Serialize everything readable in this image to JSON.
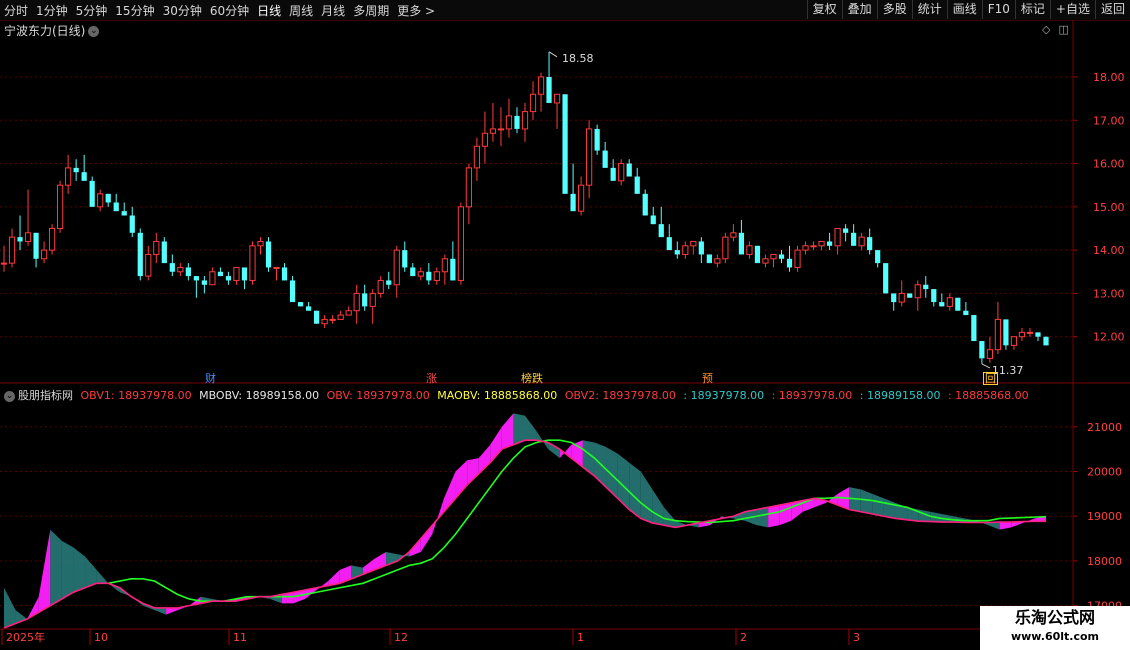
{
  "toolbar": {
    "periods": [
      "分时",
      "1分钟",
      "5分钟",
      "15分钟",
      "30分钟",
      "60分钟",
      "日线",
      "周线",
      "月线",
      "多周期",
      "更多 >"
    ],
    "active_period": "日线",
    "right_tools": [
      "复权",
      "叠加",
      "多股",
      "统计",
      "画线",
      "F10",
      "标记",
      "+自选",
      "返回"
    ]
  },
  "stock": {
    "name": "宁波东力(日线)"
  },
  "price_axis": {
    "ticks": [
      "18.00",
      "17.00",
      "16.00",
      "15.00",
      "14.00",
      "13.00",
      "12.00"
    ]
  },
  "annotations": {
    "high": "18.58",
    "low": "11.37"
  },
  "event_tags": [
    {
      "label": "财",
      "color": "#4a8cff"
    },
    {
      "label": "涨",
      "color": "#ff5050"
    },
    {
      "label": "榜跌",
      "color": "#ffd040"
    },
    {
      "label": "预",
      "color": "#ff9020"
    },
    {
      "label": "回",
      "color": "#ffcc33"
    }
  ],
  "indicator": {
    "name": "股朋指标网",
    "values": [
      {
        "text": "OBV1: 18937978.00",
        "color": "#ff3b3b"
      },
      {
        "text": "MBOBV: 18989158.00",
        "color": "#e6e6e6"
      },
      {
        "text": "OBV: 18937978.00",
        "color": "#ff3b3b"
      },
      {
        "text": "MAOBV: 18885868.00",
        "color": "#ffff40"
      },
      {
        "text": "OBV2: 18937978.00",
        "color": "#ff3b3b"
      },
      {
        "text": ": 18937978.00",
        "color": "#30c8c8"
      },
      {
        "text": ": 18937978.00",
        "color": "#ff3b3b"
      },
      {
        "text": ": 18989158.00",
        "color": "#30c8c8"
      },
      {
        "text": ": 18885868.00",
        "color": "#ff3b3b"
      }
    ],
    "axis_ticks": [
      "21000",
      "20000",
      "19000",
      "18000",
      "17000"
    ]
  },
  "time_axis": {
    "labels": [
      "2025年",
      "10",
      "11",
      "12",
      "1",
      "2",
      "3"
    ]
  },
  "watermark": {
    "line1": "乐淘公式网",
    "line2": "www.60lt.com"
  },
  "colors": {
    "up": "#ff3b3b",
    "down": "#54ffff",
    "grid": "#5a0000",
    "magenta": "#ff20ff",
    "teal": "#2a8080",
    "green": "#20ff20",
    "pink": "#ff2080"
  },
  "chart_data": {
    "type": "candlestick",
    "ylim": [
      11.0,
      18.9
    ],
    "candles": [
      [
        13.7,
        14.1,
        13.5,
        13.7
      ],
      [
        13.7,
        14.5,
        13.6,
        14.3
      ],
      [
        14.3,
        14.8,
        14.0,
        14.2
      ],
      [
        14.2,
        15.4,
        14.1,
        14.4
      ],
      [
        14.4,
        14.4,
        13.6,
        13.8
      ],
      [
        13.8,
        14.2,
        13.7,
        14.0
      ],
      [
        14.0,
        14.6,
        13.9,
        14.5
      ],
      [
        14.5,
        15.6,
        14.4,
        15.5
      ],
      [
        15.5,
        16.2,
        15.3,
        15.9
      ],
      [
        15.9,
        16.1,
        15.6,
        15.8
      ],
      [
        15.8,
        16.2,
        15.7,
        15.6
      ],
      [
        15.6,
        15.7,
        15.2,
        15.0
      ],
      [
        15.0,
        15.4,
        14.9,
        15.3
      ],
      [
        15.3,
        15.3,
        15.0,
        15.1
      ],
      [
        15.1,
        15.3,
        14.9,
        14.9
      ],
      [
        14.9,
        15.1,
        14.8,
        14.8
      ],
      [
        14.8,
        15.0,
        14.3,
        14.4
      ],
      [
        14.4,
        14.5,
        13.3,
        13.4
      ],
      [
        13.4,
        14.1,
        13.3,
        13.9
      ],
      [
        13.9,
        14.4,
        13.7,
        14.2
      ],
      [
        14.2,
        14.3,
        13.8,
        13.7
      ],
      [
        13.7,
        13.9,
        13.4,
        13.5
      ],
      [
        13.5,
        13.7,
        13.4,
        13.6
      ],
      [
        13.6,
        13.7,
        13.3,
        13.4
      ],
      [
        13.4,
        13.4,
        12.9,
        13.3
      ],
      [
        13.3,
        13.4,
        13.0,
        13.2
      ],
      [
        13.2,
        13.6,
        13.2,
        13.5
      ],
      [
        13.5,
        13.6,
        13.4,
        13.4
      ],
      [
        13.4,
        13.5,
        13.2,
        13.3
      ],
      [
        13.3,
        13.6,
        13.2,
        13.6
      ],
      [
        13.6,
        13.6,
        13.1,
        13.3
      ],
      [
        13.3,
        14.2,
        13.2,
        14.1
      ],
      [
        14.1,
        14.3,
        13.9,
        14.2
      ],
      [
        14.2,
        14.3,
        13.5,
        13.6
      ],
      [
        13.6,
        13.6,
        13.3,
        13.6
      ],
      [
        13.6,
        13.7,
        13.3,
        13.3
      ],
      [
        13.3,
        13.4,
        12.9,
        12.8
      ],
      [
        12.8,
        12.8,
        12.7,
        12.7
      ],
      [
        12.7,
        12.8,
        12.6,
        12.6
      ],
      [
        12.6,
        12.6,
        12.3,
        12.3
      ],
      [
        12.3,
        12.5,
        12.2,
        12.4
      ],
      [
        12.4,
        12.5,
        12.3,
        12.4
      ],
      [
        12.4,
        12.6,
        12.4,
        12.5
      ],
      [
        12.5,
        12.7,
        12.5,
        12.6
      ],
      [
        12.6,
        13.2,
        12.3,
        13.0
      ],
      [
        13.0,
        13.2,
        12.6,
        12.7
      ],
      [
        12.7,
        13.1,
        12.3,
        13.0
      ],
      [
        13.0,
        13.4,
        12.9,
        13.3
      ],
      [
        13.3,
        13.5,
        13.1,
        13.2
      ],
      [
        13.2,
        14.1,
        12.9,
        14.0
      ],
      [
        14.0,
        14.2,
        13.5,
        13.6
      ],
      [
        13.6,
        13.7,
        13.4,
        13.4
      ],
      [
        13.4,
        13.6,
        13.3,
        13.5
      ],
      [
        13.5,
        13.7,
        13.2,
        13.3
      ],
      [
        13.3,
        13.6,
        13.2,
        13.5
      ],
      [
        13.5,
        13.9,
        13.2,
        13.8
      ],
      [
        13.8,
        14.2,
        13.3,
        13.3
      ],
      [
        13.3,
        15.1,
        13.2,
        15.0
      ],
      [
        15.0,
        16.0,
        14.6,
        15.9
      ],
      [
        15.9,
        16.6,
        15.6,
        16.4
      ],
      [
        16.4,
        17.2,
        16.0,
        16.7
      ],
      [
        16.7,
        17.4,
        16.5,
        16.8
      ],
      [
        16.8,
        17.3,
        16.4,
        16.8
      ],
      [
        16.8,
        17.5,
        16.6,
        17.1
      ],
      [
        17.1,
        17.3,
        16.7,
        16.8
      ],
      [
        16.8,
        17.4,
        16.5,
        17.2
      ],
      [
        17.2,
        17.9,
        17.0,
        17.6
      ],
      [
        17.6,
        18.1,
        17.2,
        18.0
      ],
      [
        18.0,
        18.58,
        17.8,
        17.4
      ],
      [
        17.4,
        17.6,
        16.8,
        17.6
      ],
      [
        17.6,
        17.6,
        15.8,
        15.3
      ],
      [
        15.3,
        16.0,
        15.0,
        14.9
      ],
      [
        14.9,
        15.7,
        14.8,
        15.5
      ],
      [
        15.5,
        17.0,
        15.2,
        16.8
      ],
      [
        16.8,
        16.9,
        16.2,
        16.3
      ],
      [
        16.3,
        16.5,
        16.0,
        15.9
      ],
      [
        15.9,
        16.1,
        15.8,
        15.6
      ],
      [
        15.6,
        16.1,
        15.5,
        16.0
      ],
      [
        16.0,
        16.1,
        15.8,
        15.7
      ],
      [
        15.7,
        15.9,
        15.4,
        15.3
      ],
      [
        15.3,
        15.4,
        14.8,
        14.8
      ],
      [
        14.8,
        15.0,
        14.6,
        14.6
      ],
      [
        14.6,
        15.0,
        14.5,
        14.3
      ],
      [
        14.3,
        14.6,
        14.2,
        14.0
      ],
      [
        14.0,
        14.2,
        13.8,
        13.9
      ],
      [
        13.9,
        14.2,
        13.8,
        14.1
      ],
      [
        14.1,
        14.2,
        13.9,
        14.2
      ],
      [
        14.2,
        14.3,
        13.7,
        13.9
      ],
      [
        13.9,
        13.9,
        13.7,
        13.7
      ],
      [
        13.7,
        13.9,
        13.6,
        13.8
      ],
      [
        13.8,
        14.4,
        13.7,
        14.3
      ],
      [
        14.3,
        14.6,
        14.2,
        14.4
      ],
      [
        14.4,
        14.7,
        13.9,
        13.9
      ],
      [
        13.9,
        14.2,
        13.8,
        14.1
      ],
      [
        14.1,
        14.1,
        13.8,
        13.7
      ],
      [
        13.7,
        13.9,
        13.6,
        13.8
      ],
      [
        13.8,
        13.8,
        13.6,
        13.9
      ],
      [
        13.9,
        14.0,
        13.7,
        13.8
      ],
      [
        13.8,
        14.1,
        13.5,
        13.6
      ],
      [
        13.6,
        14.1,
        13.5,
        14.0
      ],
      [
        14.0,
        14.2,
        13.9,
        14.1
      ],
      [
        14.1,
        14.2,
        14.0,
        14.1
      ],
      [
        14.1,
        14.2,
        14.0,
        14.2
      ],
      [
        14.2,
        14.4,
        14.0,
        14.1
      ],
      [
        14.1,
        14.5,
        13.9,
        14.5
      ],
      [
        14.5,
        14.6,
        14.2,
        14.4
      ],
      [
        14.4,
        14.6,
        14.1,
        14.1
      ],
      [
        14.1,
        14.4,
        14.0,
        14.3
      ],
      [
        14.3,
        14.5,
        13.9,
        14.0
      ],
      [
        14.0,
        14.0,
        13.6,
        13.7
      ],
      [
        13.7,
        13.7,
        13.0,
        13.0
      ],
      [
        13.0,
        13.0,
        12.6,
        12.8
      ],
      [
        12.8,
        13.3,
        12.7,
        13.0
      ],
      [
        13.0,
        13.0,
        12.9,
        12.9
      ],
      [
        12.9,
        13.3,
        12.6,
        13.2
      ],
      [
        13.2,
        13.4,
        12.9,
        13.1
      ],
      [
        13.1,
        13.1,
        12.7,
        12.8
      ],
      [
        12.8,
        13.0,
        12.7,
        12.7
      ],
      [
        12.7,
        13.0,
        12.6,
        12.9
      ],
      [
        12.9,
        12.9,
        12.6,
        12.6
      ],
      [
        12.6,
        12.8,
        12.5,
        12.5
      ],
      [
        12.5,
        12.5,
        11.9,
        11.9
      ],
      [
        11.9,
        11.9,
        11.37,
        11.5
      ],
      [
        11.5,
        12.0,
        11.4,
        11.7
      ],
      [
        11.7,
        12.8,
        11.6,
        12.4
      ],
      [
        12.4,
        12.4,
        11.7,
        11.8
      ],
      [
        11.8,
        12.0,
        11.7,
        12.0
      ],
      [
        12.0,
        12.2,
        11.9,
        12.1
      ],
      [
        12.1,
        12.2,
        12.0,
        12.1
      ],
      [
        12.1,
        12.1,
        11.9,
        12.0
      ],
      [
        12.0,
        12.0,
        11.8,
        11.8
      ]
    ],
    "obv_ylim": [
      16500,
      21600
    ],
    "obv": [
      17400,
      16900,
      16700,
      17200,
      18700,
      18450,
      18300,
      18100,
      17800,
      17500,
      17300,
      17200,
      17000,
      16900,
      16800,
      16900,
      17000,
      17200,
      17150,
      17100,
      17150,
      17200,
      17200,
      17150,
      17050,
      17050,
      17150,
      17350,
      17550,
      17800,
      17900,
      17850,
      18050,
      18200,
      18150,
      18100,
      18200,
      18600,
      19400,
      20000,
      20250,
      20300,
      20600,
      21000,
      21300,
      21250,
      20900,
      20500,
      20300,
      20600,
      20700,
      20650,
      20550,
      20400,
      20200,
      20000,
      19600,
      19200,
      18900,
      18800,
      18750,
      18800,
      19000,
      18950,
      18900,
      18800,
      18750,
      18800,
      18900,
      19100,
      19200,
      19300,
      19500,
      19650,
      19600,
      19500,
      19400,
      19300,
      19200,
      19150,
      19100,
      19050,
      19000,
      18950,
      18900,
      18800,
      18700,
      18750,
      18850,
      18950,
      19000
    ],
    "mbobv": [
      null,
      null,
      null,
      null,
      null,
      null,
      null,
      null,
      null,
      17500,
      17550,
      17600,
      17600,
      17550,
      17400,
      17250,
      17150,
      17100,
      17100,
      17100,
      17150,
      17200,
      17200,
      17200,
      17200,
      17200,
      17250,
      17300,
      17350,
      17400,
      17450,
      17500,
      17600,
      17700,
      17800,
      17900,
      17950,
      18050,
      18300,
      18600,
      18950,
      19300,
      19650,
      20000,
      20300,
      20550,
      20650,
      20700,
      20700,
      20650,
      20500,
      20300,
      20050,
      19800,
      19550,
      19300,
      19100,
      18950,
      18900,
      18880,
      18870,
      18860,
      18880,
      18900,
      18950,
      19000,
      19050,
      19100,
      19200,
      19300,
      19400,
      19400,
      19420,
      19400,
      19380,
      19350,
      19300,
      19250,
      19200,
      19100,
      19000,
      18950,
      18920,
      18900,
      18900,
      18900,
      18950,
      18960,
      18970,
      18980,
      18990
    ],
    "maobv": [
      16500,
      16600,
      16700,
      16850,
      17000,
      17150,
      17300,
      17400,
      17500,
      17500,
      17400,
      17200,
      17050,
      16950,
      16950,
      16950,
      17000,
      17050,
      17100,
      17100,
      17100,
      17150,
      17200,
      17200,
      17250,
      17300,
      17350,
      17400,
      17450,
      17500,
      17600,
      17700,
      17800,
      17900,
      18000,
      18200,
      18500,
      18800,
      19100,
      19400,
      19700,
      19950,
      20200,
      20500,
      20600,
      20700,
      20700,
      20650,
      20500,
      20300,
      20100,
      19900,
      19650,
      19400,
      19150,
      18950,
      18850,
      18800,
      18750,
      18800,
      18850,
      18900,
      18950,
      19000,
      19100,
      19150,
      19200,
      19250,
      19300,
      19350,
      19400,
      19350,
      19250,
      19150,
      19100,
      19050,
      19000,
      18950,
      18920,
      18890,
      18880,
      18870,
      18870,
      18860,
      18860,
      18860,
      18870,
      18870,
      18880,
      18885,
      18886
    ]
  }
}
